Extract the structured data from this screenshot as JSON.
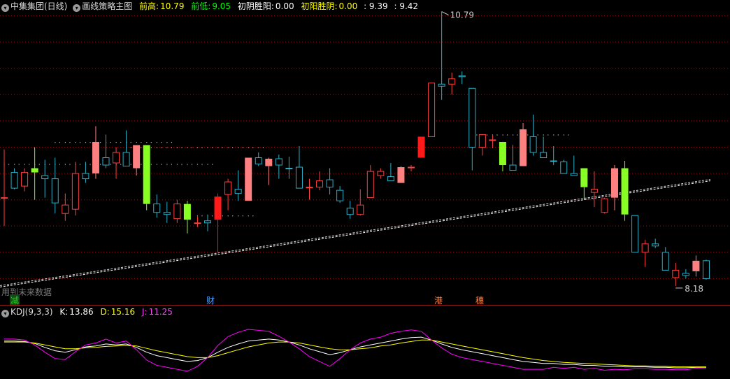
{
  "header": {
    "stock": "中集集团(日线)",
    "indicator": "画线策略主图",
    "prev_high_label": "前高:",
    "prev_high_value": "10.79",
    "prev_low_label": "前低:",
    "prev_low_value": "9.05",
    "yin_label": "初阴胜阳:",
    "yin_value": "0.00",
    "yang_label": "初阳胜阴:",
    "yang_value": "0.00",
    "extra1": ": 9.39",
    "extra2": ": 9.42"
  },
  "kdj_header": {
    "name": "KDJ(9,3,3)",
    "k_label": "K:",
    "k_value": "13.86",
    "d_label": "D:",
    "d_value": "15.16",
    "j_label": "J:",
    "j_value": "11.25"
  },
  "annotations": {
    "high_label": "10.79",
    "low_label": "8.18",
    "note": "用到未来数据"
  },
  "markers": [
    {
      "text": "减",
      "color": "#22cc22",
      "bg": "#1a5a1a"
    },
    {
      "text": "财",
      "color": "#4aa0ff",
      "bg": ""
    },
    {
      "text": "港",
      "color": "#ff8040",
      "bg": ""
    },
    {
      "text": "穗",
      "color": "#ff8040",
      "bg": ""
    }
  ],
  "colors": {
    "up": "#ff4040",
    "down": "#2ab0c8",
    "strong_down": "#88ff22",
    "strong_up": "#ff1a1a",
    "pink": "#ff8080",
    "k_line": "#ffffff",
    "d_line": "#ffff00",
    "j_line": "#ff00ff",
    "grid": "#8b1010",
    "header_up": "#ffff00",
    "header_down": "#00ff00"
  },
  "chart_data": [
    {
      "type": "candlestick",
      "title": "中集集团(日线)",
      "ylim": [
        8.0,
        10.9
      ],
      "candles": [
        {
          "o": 9.02,
          "h": 9.48,
          "l": 8.75,
          "c": 9.02,
          "s": "r"
        },
        {
          "o": 9.26,
          "h": 9.3,
          "l": 9.1,
          "c": 9.11,
          "s": "c"
        },
        {
          "o": 9.13,
          "h": 9.3,
          "l": 9.08,
          "c": 9.26,
          "s": "r"
        },
        {
          "o": 9.3,
          "h": 9.5,
          "l": 9.0,
          "c": 9.26,
          "s": "g"
        },
        {
          "o": 9.23,
          "h": 9.38,
          "l": 9.02,
          "c": 9.2,
          "s": "c"
        },
        {
          "o": 9.2,
          "h": 9.4,
          "l": 8.87,
          "c": 8.97,
          "s": "c"
        },
        {
          "o": 8.87,
          "h": 9.06,
          "l": 8.8,
          "c": 8.95,
          "s": "r"
        },
        {
          "o": 8.91,
          "h": 9.36,
          "l": 8.85,
          "c": 9.25,
          "s": "r"
        },
        {
          "o": 9.2,
          "h": 9.36,
          "l": 9.16,
          "c": 9.25,
          "s": "c"
        },
        {
          "o": 9.25,
          "h": 9.7,
          "l": 9.2,
          "c": 9.55,
          "s": "p"
        },
        {
          "o": 9.4,
          "h": 9.62,
          "l": 9.3,
          "c": 9.33,
          "s": "c"
        },
        {
          "o": 9.35,
          "h": 9.5,
          "l": 9.2,
          "c": 9.45,
          "s": "r"
        },
        {
          "o": 9.45,
          "h": 9.66,
          "l": 9.32,
          "c": 9.32,
          "s": "c"
        },
        {
          "o": 9.3,
          "h": 9.5,
          "l": 9.23,
          "c": 9.52,
          "s": "p"
        },
        {
          "o": 9.52,
          "h": 9.5,
          "l": 8.9,
          "c": 8.96,
          "s": "g"
        },
        {
          "o": 8.96,
          "h": 9.05,
          "l": 8.83,
          "c": 8.88,
          "s": "c"
        },
        {
          "o": 8.88,
          "h": 8.98,
          "l": 8.78,
          "c": 8.86,
          "s": "c"
        },
        {
          "o": 8.82,
          "h": 9.0,
          "l": 8.78,
          "c": 8.96,
          "s": "r"
        },
        {
          "o": 8.96,
          "h": 8.99,
          "l": 8.68,
          "c": 8.81,
          "s": "g"
        },
        {
          "o": 8.78,
          "h": 8.84,
          "l": 8.74,
          "c": 8.78,
          "s": "r"
        },
        {
          "o": 8.78,
          "h": 8.86,
          "l": 8.7,
          "c": 8.8,
          "s": "c"
        },
        {
          "o": 8.81,
          "h": 9.06,
          "l": 8.5,
          "c": 9.03,
          "s": "R"
        },
        {
          "o": 9.05,
          "h": 9.2,
          "l": 8.9,
          "c": 9.17,
          "s": "r"
        },
        {
          "o": 9.1,
          "h": 9.28,
          "l": 8.99,
          "c": 9.06,
          "s": "c"
        },
        {
          "o": 8.99,
          "h": 9.4,
          "l": 8.99,
          "c": 9.4,
          "s": "p"
        },
        {
          "o": 9.4,
          "h": 9.45,
          "l": 9.32,
          "c": 9.34,
          "s": "c"
        },
        {
          "o": 9.32,
          "h": 9.4,
          "l": 9.14,
          "c": 9.39,
          "s": "p"
        },
        {
          "o": 9.39,
          "h": 9.43,
          "l": 9.2,
          "c": 9.33,
          "s": "c"
        },
        {
          "o": 9.3,
          "h": 9.41,
          "l": 9.2,
          "c": 9.3,
          "s": "c"
        },
        {
          "o": 9.31,
          "h": 9.51,
          "l": 9.21,
          "c": 9.11,
          "s": "c"
        },
        {
          "o": 9.12,
          "h": 9.2,
          "l": 9.0,
          "c": 9.12,
          "s": "r"
        },
        {
          "o": 9.12,
          "h": 9.27,
          "l": 9.09,
          "c": 9.18,
          "s": "r"
        },
        {
          "o": 9.19,
          "h": 9.3,
          "l": 9.05,
          "c": 9.12,
          "s": "c"
        },
        {
          "o": 9.09,
          "h": 9.13,
          "l": 8.97,
          "c": 8.99,
          "s": "c"
        },
        {
          "o": 8.92,
          "h": 8.99,
          "l": 8.82,
          "c": 8.86,
          "s": "c"
        },
        {
          "o": 8.86,
          "h": 9.1,
          "l": 8.85,
          "c": 8.95,
          "s": "r"
        },
        {
          "o": 9.02,
          "h": 9.33,
          "l": 9.02,
          "c": 9.27,
          "s": "r"
        },
        {
          "o": 9.27,
          "h": 9.3,
          "l": 9.2,
          "c": 9.23,
          "s": "r"
        },
        {
          "o": 9.22,
          "h": 9.35,
          "l": 9.18,
          "c": 9.18,
          "s": "c"
        },
        {
          "o": 9.16,
          "h": 9.32,
          "l": 9.16,
          "c": 9.31,
          "s": "p"
        },
        {
          "o": 9.31,
          "h": 9.33,
          "l": 9.27,
          "c": 9.31,
          "s": "r"
        },
        {
          "o": 9.4,
          "h": 9.6,
          "l": 9.4,
          "c": 9.6,
          "s": "R"
        },
        {
          "o": 9.6,
          "h": 10.11,
          "l": 9.6,
          "c": 10.11,
          "s": "r"
        },
        {
          "o": 10.08,
          "h": 10.79,
          "l": 9.95,
          "c": 10.1,
          "s": "c"
        },
        {
          "o": 10.1,
          "h": 10.21,
          "l": 10.0,
          "c": 10.15,
          "s": "r"
        },
        {
          "o": 10.17,
          "h": 10.22,
          "l": 10.1,
          "c": 10.18,
          "s": "c"
        },
        {
          "o": 10.06,
          "h": 10.06,
          "l": 9.28,
          "c": 9.5,
          "s": "c"
        },
        {
          "o": 9.5,
          "h": 9.62,
          "l": 9.42,
          "c": 9.62,
          "s": "r"
        },
        {
          "o": 9.57,
          "h": 9.61,
          "l": 9.49,
          "c": 9.57,
          "s": "r"
        },
        {
          "o": 9.55,
          "h": 9.55,
          "l": 9.27,
          "c": 9.33,
          "s": "g"
        },
        {
          "o": 9.33,
          "h": 9.52,
          "l": 9.28,
          "c": 9.28,
          "s": "c"
        },
        {
          "o": 9.32,
          "h": 9.73,
          "l": 9.32,
          "c": 9.67,
          "s": "p"
        },
        {
          "o": 9.6,
          "h": 9.81,
          "l": 9.42,
          "c": 9.45,
          "s": "c"
        },
        {
          "o": 9.45,
          "h": 9.6,
          "l": 9.4,
          "c": 9.4,
          "s": "c"
        },
        {
          "o": 9.37,
          "h": 9.51,
          "l": 9.33,
          "c": 9.37,
          "s": "c"
        },
        {
          "o": 9.36,
          "h": 9.38,
          "l": 9.26,
          "c": 9.25,
          "s": "c"
        },
        {
          "o": 9.25,
          "h": 9.42,
          "l": 9.23,
          "c": 9.23,
          "s": "c"
        },
        {
          "o": 9.3,
          "h": 9.3,
          "l": 9.0,
          "c": 9.12,
          "s": "g"
        },
        {
          "o": 9.1,
          "h": 9.27,
          "l": 8.93,
          "c": 9.07,
          "s": "r"
        },
        {
          "o": 8.88,
          "h": 9.02,
          "l": 8.87,
          "c": 9.01,
          "s": "r"
        },
        {
          "o": 9.02,
          "h": 9.33,
          "l": 8.9,
          "c": 9.3,
          "s": "p"
        },
        {
          "o": 9.3,
          "h": 9.37,
          "l": 8.8,
          "c": 8.86,
          "s": "g"
        },
        {
          "o": 8.85,
          "h": 8.85,
          "l": 8.6,
          "c": 8.5,
          "s": "c"
        },
        {
          "o": 8.5,
          "h": 8.62,
          "l": 8.36,
          "c": 8.58,
          "s": "r"
        },
        {
          "o": 8.58,
          "h": 8.63,
          "l": 8.54,
          "c": 8.56,
          "s": "c"
        },
        {
          "o": 8.5,
          "h": 8.55,
          "l": 8.4,
          "c": 8.33,
          "s": "c"
        },
        {
          "o": 8.26,
          "h": 8.4,
          "l": 8.18,
          "c": 8.33,
          "s": "r"
        },
        {
          "o": 8.3,
          "h": 8.34,
          "l": 8.25,
          "c": 8.28,
          "s": "c"
        },
        {
          "o": 8.32,
          "h": 8.47,
          "l": 8.27,
          "c": 8.42,
          "s": "p"
        },
        {
          "o": 8.42,
          "h": 8.43,
          "l": 8.24,
          "c": 8.25,
          "s": "c"
        }
      ],
      "trendline": {
        "from": [
          0,
          8.17
        ],
        "to": [
          69,
          9.18
        ]
      }
    },
    {
      "type": "line",
      "title": "KDJ(9,3,3)",
      "ylim": [
        -10,
        115
      ],
      "series": [
        {
          "name": "K",
          "values": [
            68,
            68,
            67,
            63,
            55,
            48,
            45,
            50,
            56,
            58,
            62,
            60,
            62,
            55,
            45,
            38,
            34,
            30,
            26,
            28,
            34,
            45,
            55,
            62,
            68,
            70,
            72,
            70,
            66,
            60,
            52,
            46,
            40,
            44,
            50,
            56,
            60,
            64,
            68,
            72,
            75,
            76,
            70,
            62,
            55,
            50,
            46,
            42,
            38,
            34,
            30,
            26,
            24,
            22,
            22,
            20,
            20,
            18,
            18,
            16,
            16,
            15,
            15,
            15,
            14,
            14,
            13,
            13,
            14,
            14
          ]
        },
        {
          "name": "D",
          "values": [
            66,
            66,
            66,
            64,
            60,
            56,
            52,
            52,
            54,
            55,
            57,
            58,
            59,
            58,
            53,
            48,
            44,
            40,
            36,
            34,
            34,
            38,
            44,
            50,
            56,
            60,
            64,
            66,
            66,
            64,
            60,
            56,
            52,
            50,
            50,
            52,
            54,
            58,
            60,
            64,
            67,
            70,
            70,
            66,
            62,
            58,
            54,
            50,
            46,
            42,
            38,
            34,
            31,
            28,
            26,
            24,
            23,
            22,
            21,
            20,
            19,
            18,
            17,
            17,
            16,
            16,
            15,
            15,
            15,
            15
          ]
        },
        {
          "name": "J",
          "values": [
            72,
            72,
            70,
            60,
            45,
            32,
            30,
            46,
            60,
            64,
            72,
            64,
            68,
            50,
            29,
            18,
            14,
            10,
            6,
            16,
            34,
            59,
            77,
            86,
            92,
            90,
            88,
            78,
            66,
            52,
            36,
            26,
            16,
            32,
            50,
            64,
            72,
            76,
            84,
            88,
            91,
            88,
            70,
            54,
            41,
            34,
            30,
            26,
            22,
            18,
            14,
            10,
            10,
            10,
            14,
            12,
            14,
            10,
            12,
            8,
            10,
            9,
            11,
            11,
            10,
            10,
            9,
            9,
            12,
            11
          ]
        }
      ]
    }
  ]
}
